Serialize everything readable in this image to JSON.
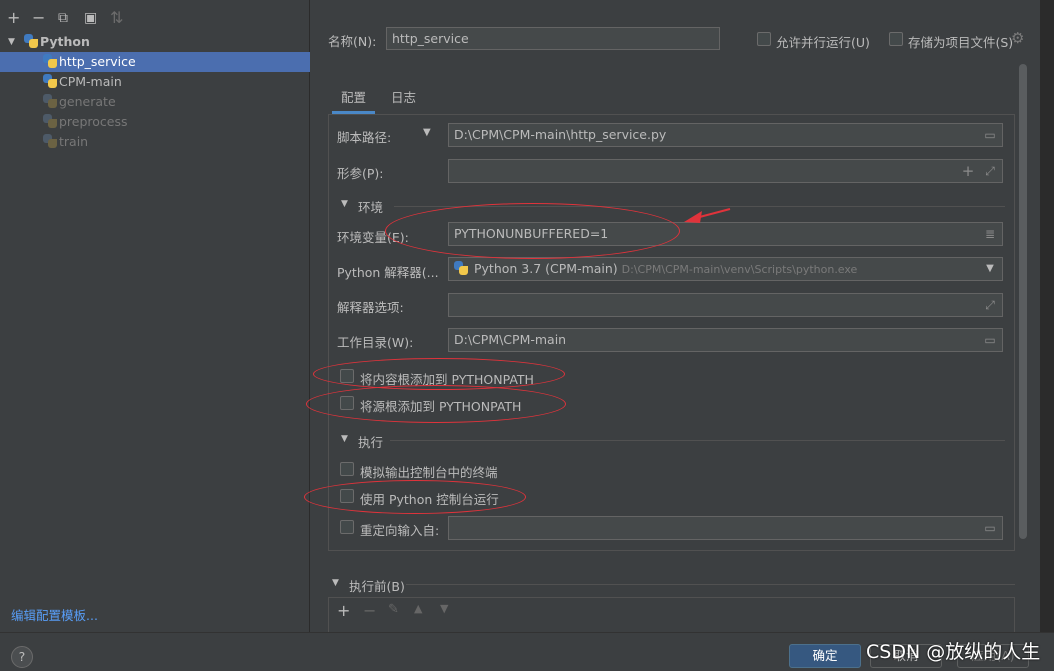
{
  "toolbar": {
    "add": "+",
    "remove": "−",
    "copy": "⧉",
    "folder": "▣",
    "sort": "⇅"
  },
  "tree": {
    "root_label": "Python",
    "items": [
      {
        "label": "http_service",
        "selected": true,
        "dim": false
      },
      {
        "label": "CPM-main",
        "selected": false,
        "dim": false
      },
      {
        "label": "generate",
        "selected": false,
        "dim": true
      },
      {
        "label": "preprocess",
        "selected": false,
        "dim": true
      },
      {
        "label": "train",
        "selected": false,
        "dim": true
      }
    ]
  },
  "edit_templates_link": "编辑配置模板...",
  "name_label": "名称(N):",
  "name_value": "http_service",
  "allow_parallel_label": "允许并行运行(U)",
  "store_as_project_label": "存储为项目文件(S)",
  "tabs": [
    "配置",
    "日志"
  ],
  "script_path_label": "脚本路径:",
  "script_path_value": "D:\\CPM\\CPM-main\\http_service.py",
  "params_label": "形参(P):",
  "env_section": "环境",
  "env_vars_label": "环境变量(E):",
  "env_vars_value": "PYTHONUNBUFFERED=1",
  "interpreter_label": "Python 解释器(...",
  "interpreter_value": "Python 3.7 (CPM-main)",
  "interpreter_path": "D:\\CPM\\CPM-main\\venv\\Scripts\\python.exe",
  "interp_options_label": "解释器选项:",
  "workdir_label": "工作目录(W):",
  "workdir_value": "D:\\CPM\\CPM-main",
  "add_content_roots_label": "将内容根添加到 PYTHONPATH",
  "add_source_roots_label": "将源根添加到 PYTHONPATH",
  "exec_section": "执行",
  "emulate_terminal_label": "模拟输出控制台中的终端",
  "python_console_label": "使用 Python 控制台运行",
  "redirect_input_label": "重定向输入自:",
  "before_launch_section": "执行前(B)",
  "buttons": {
    "ok": "确定",
    "cancel": "取消",
    "apply": "应用(A)"
  },
  "help": "?",
  "watermark": "CSDN @放纵的人生",
  "colors": {
    "selection": "#4b6eaf",
    "accent": "#4a88c7",
    "annotation": "#e0333b",
    "link": "#589df6"
  }
}
